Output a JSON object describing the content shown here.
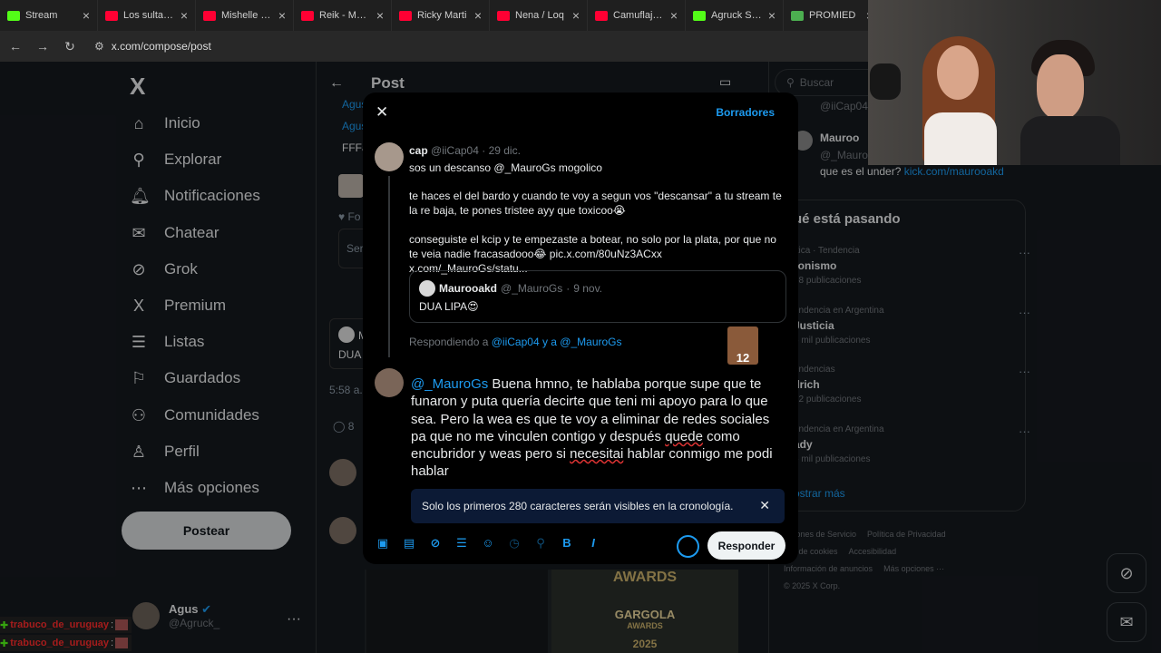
{
  "browser": {
    "tabs": [
      {
        "label": "Stream",
        "color": "#53fc18"
      },
      {
        "label": "Los sultanes",
        "color": "#ff0033"
      },
      {
        "label": "Mishelle Ma",
        "color": "#ff0033"
      },
      {
        "label": "Reik - Me N",
        "color": "#ff0033"
      },
      {
        "label": "Ricky Marti",
        "color": "#ff0033"
      },
      {
        "label": "Nena / Loq",
        "color": "#ff0033"
      },
      {
        "label": "Camuflaje R",
        "color": "#ff0033"
      },
      {
        "label": "Agruck Stre",
        "color": "#53fc18"
      },
      {
        "label": "PROMIED",
        "color": "#4caf50"
      }
    ],
    "url": "x.com/compose/post"
  },
  "sidebar": {
    "logo": "X",
    "items": [
      {
        "label": "Inicio",
        "icon": "⌂"
      },
      {
        "label": "Explorar",
        "icon": "⚲"
      },
      {
        "label": "Notificaciones",
        "icon": "🔔︎"
      },
      {
        "label": "Chatear",
        "icon": "✉"
      },
      {
        "label": "Grok",
        "icon": "⊘"
      },
      {
        "label": "Premium",
        "icon": "X"
      },
      {
        "label": "Listas",
        "icon": "☰"
      },
      {
        "label": "Guardados",
        "icon": "⚐"
      },
      {
        "label": "Comunidades",
        "icon": "⚇"
      },
      {
        "label": "Perfil",
        "icon": "♙"
      },
      {
        "label": "Más opciones",
        "icon": "⋯"
      }
    ],
    "post_button": "Postear",
    "account": {
      "name": "Agus",
      "handle": "@Agruck_"
    }
  },
  "chat_overlay": {
    "user": "trabuco_de_uruguay"
  },
  "center": {
    "title": "Post",
    "snippets": {
      "a": "Agus",
      "b": "Agus",
      "c": "FFFa",
      "d": "Fo",
      "e": "Ser",
      "f": "DUA",
      "g": "5:58 a.",
      "h": "8",
      "i": "M"
    },
    "award_text": "AWARDS",
    "award_name": "GARGOLA",
    "award_sub": "AWARDS",
    "award_year": "2025"
  },
  "right": {
    "search_placeholder": "Buscar",
    "top_handle": "@iiCap04",
    "top_name": "Mauroo",
    "top_handle2": "@_Mauro",
    "top_text": "que es el under?",
    "top_link": "kick.com/maurooakd",
    "trends_title": "ué está pasando",
    "trends": [
      {
        "context": "ítica · Tendencia",
        "name": "ronismo",
        "count": "58 publicaciones"
      },
      {
        "context": "endencia en Argentina",
        "name": "Justicia",
        "count": "6 mil publicaciones"
      },
      {
        "context": "endencias",
        "name": "llrich",
        "count": "12 publicaciones"
      },
      {
        "context": "endencia en Argentina",
        "name": "ady",
        "count": "5 mil publicaciones"
      }
    ],
    "show_more": "ostrar más",
    "footer": [
      "diciones de Servicio",
      "Política de Privacidad",
      "tica de cookies",
      "Accesibilidad",
      "Información de anuncios",
      "Más opciones ···",
      "© 2025 X Corp."
    ]
  },
  "modal": {
    "drafts": "Borradores",
    "reply_to": {
      "name": "cap",
      "handle": "@iiCap04",
      "date": "29 dic.",
      "line1": "sos un descanso @_MauroGs mogolico",
      "para2": "te haces el del bardo y cuando te voy a segun vos \"descansar\" a tu stream te la re baja, te pones tristee ayy que toxicoo😭",
      "para3": "conseguiste el kcip y te empezaste a botear, no solo por la plata, por que no te veia nadie fracasadooo😂 pic.x.com/80uNz3ACxx x.com/_MauroGs/statu..."
    },
    "quote": {
      "name": "Maurooakd",
      "handle": "@_MauroGs",
      "date": "9 nov.",
      "text": "DUA LIPA😍"
    },
    "replying_prefix": "Respondiendo a",
    "replying_mentions": "@iiCap04 y a @_MauroGs",
    "emote_label": "12",
    "draft": {
      "mention": "@_MauroGs",
      "part1": " Buena hmno, te hablaba porque supe que te funaron y puta quería decirte que teni mi apoyo para lo que sea. Pero la wea es que te voy a eliminar de redes sociales pa que no me vinculen contigo y después ",
      "quede": "quede",
      "part2": " como encubridor y weas pero si ",
      "necesitai": "necesitai",
      "part3": " hablar conmigo me podi hablar"
    },
    "notice": "Solo los primeros 280 caracteres serán visibles en la cronología.",
    "reply_button": "Responder"
  }
}
